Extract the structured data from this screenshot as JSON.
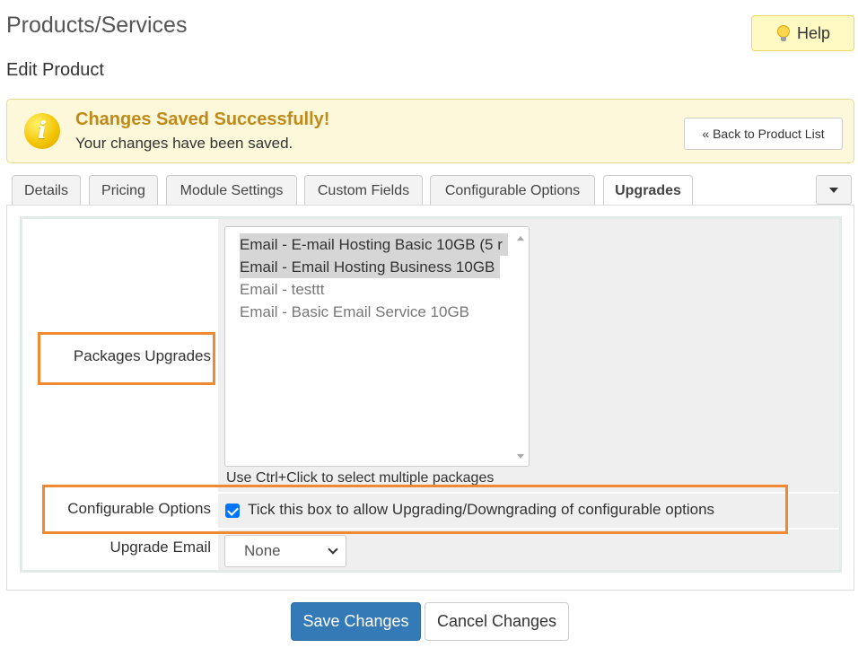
{
  "header": {
    "title": "Products/Services",
    "subtitle": "Edit Product",
    "help_label": "Help"
  },
  "alert": {
    "title": "Changes Saved Successfully!",
    "message": "Your changes have been saved.",
    "back_label": "« Back to Product List"
  },
  "tabs": [
    {
      "label": "Details"
    },
    {
      "label": "Pricing"
    },
    {
      "label": "Module Settings"
    },
    {
      "label": "Custom Fields"
    },
    {
      "label": "Configurable Options"
    },
    {
      "label": "Upgrades",
      "active": true
    }
  ],
  "form": {
    "packages_label": "Packages Upgrades",
    "packages": [
      {
        "label": "Email - E-mail Hosting Basic 10GB (5 r",
        "selected": true
      },
      {
        "label": "Email - Email Hosting Business 10GB",
        "selected": true
      },
      {
        "label": "Email - testtt",
        "selected": false
      },
      {
        "label": "Email - Basic Email Service 10GB",
        "selected": false
      }
    ],
    "packages_hint": "Use Ctrl+Click to select multiple packages",
    "configurable_label": "Configurable Options",
    "configurable_checkbox_text": "Tick this box to allow Upgrading/Downgrading of configurable options",
    "configurable_checked": true,
    "upgrade_email_label": "Upgrade Email",
    "upgrade_email_value": "None"
  },
  "actions": {
    "save_label": "Save Changes",
    "cancel_label": "Cancel Changes"
  },
  "colors": {
    "highlight": "#ef8a31",
    "primary": "#337ab7",
    "alert_bg": "#fcf8d9",
    "alert_title": "#c08a1a"
  },
  "icons": {
    "help": "lightbulb-icon",
    "alert": "info-icon",
    "tab_menu": "caret-down-icon"
  }
}
